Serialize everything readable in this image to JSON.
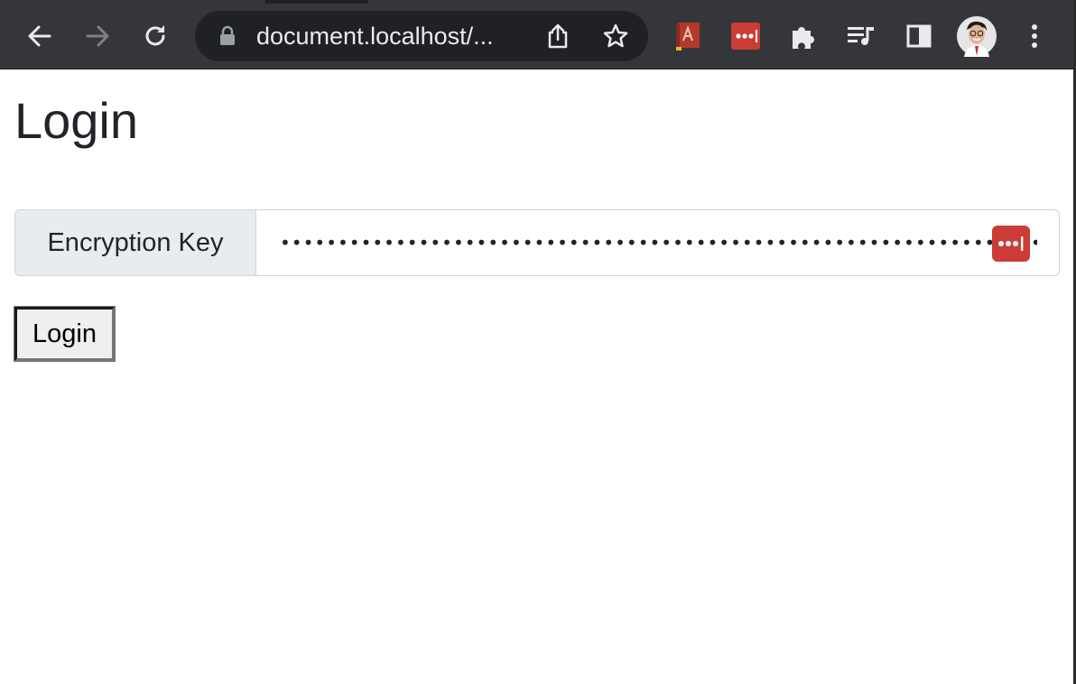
{
  "browser": {
    "url": "document.localhost/...",
    "toolbar_icons": [
      "back-arrow-icon",
      "forward-arrow-icon",
      "reload-icon",
      "lock-icon",
      "share-icon",
      "bookmark-star-icon",
      "acrobat-extension-icon",
      "lastpass-extension-icon",
      "extensions-puzzle-icon",
      "media-control-icon",
      "side-panel-icon",
      "profile-avatar",
      "menu-kebab-icon"
    ],
    "colors": {
      "frame": "#35363a",
      "omnibox": "#202124",
      "icon": "#e8eaed",
      "icon_disabled": "#808186",
      "lastpass_red": "#cc3c37"
    }
  },
  "page": {
    "title": "Login",
    "key_label": "Encryption Key",
    "key_value": "••••••••••••••••••••••••••••••••••••••••••••••••••••••••••••••••••••••••••••",
    "login_button": "Login"
  }
}
